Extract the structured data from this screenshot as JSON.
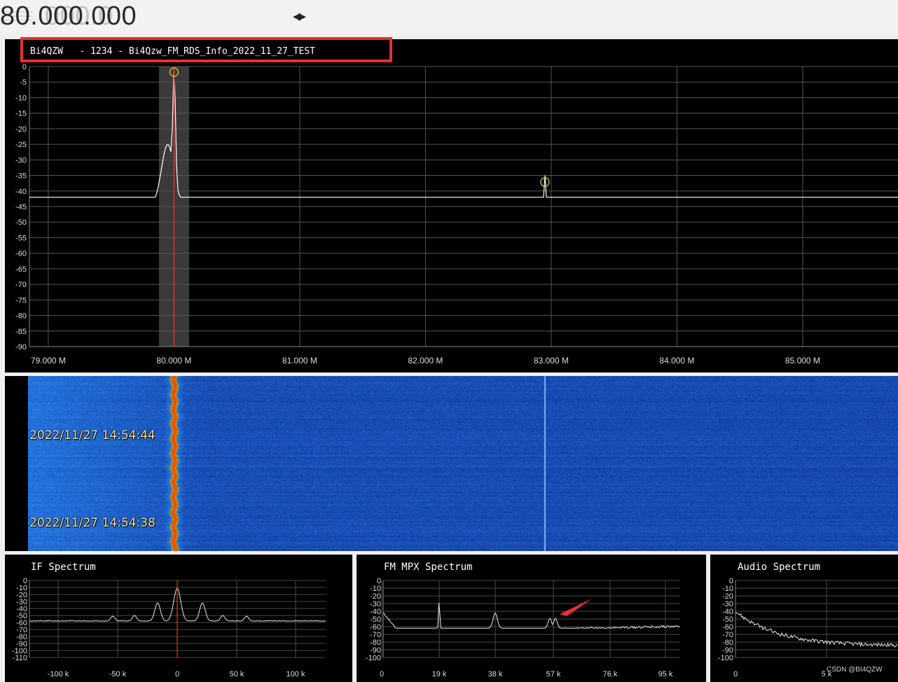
{
  "frequency": {
    "dim_digits": "000.0",
    "main_digits": "80.000.000",
    "arrows_glyph": "◂▸"
  },
  "main_spectrum": {
    "station_label": "Bi4QZW   - 1234 - Bi4Qzw_FM_RDS_Info_2022_11_27_TEST",
    "y_ticks": [
      "0",
      "-5",
      "-10",
      "-15",
      "-20",
      "-25",
      "-30",
      "-35",
      "-40",
      "-45",
      "-50",
      "-55",
      "-60",
      "-65",
      "-70",
      "-75",
      "-80",
      "-85",
      "-90"
    ],
    "x_ticks": [
      "79.000 M",
      "80.000 M",
      "81.000 M",
      "82.000 M",
      "83.000 M",
      "84.000 M",
      "85.000 M"
    ],
    "tuned_frequency": "80.000 M",
    "peak_markers": [
      "80.000 M",
      "82.950 M"
    ]
  },
  "waterfall": {
    "timestamps": [
      "2022/11/27 14:54:44",
      "2022/11/27 14:54:38"
    ]
  },
  "if_spectrum": {
    "title": "IF Spectrum",
    "y_ticks": [
      "0",
      "-10",
      "-20",
      "-30",
      "-40",
      "-50",
      "-60",
      "-70",
      "-80",
      "-90",
      "-100",
      "-110"
    ],
    "x_ticks": [
      "-100 k",
      "-50 k",
      "0",
      "50 k",
      "100 k"
    ]
  },
  "fm_mpx_spectrum": {
    "title": "FM MPX Spectrum",
    "y_ticks": [
      "0",
      "-10",
      "-20",
      "-30",
      "-40",
      "-50",
      "-60",
      "-70",
      "-80",
      "-90",
      "-100"
    ],
    "x_ticks": [
      "0",
      "19 k",
      "38 k",
      "57 k",
      "76 k",
      "95 k"
    ]
  },
  "audio_spectrum": {
    "title": "Audio Spectrum",
    "y_ticks": [
      "0",
      "-10",
      "-20",
      "-30",
      "-40",
      "-50",
      "-60",
      "-70",
      "-80",
      "-90",
      "-100"
    ],
    "x_ticks": [
      "0",
      "5 k"
    ]
  },
  "watermark": "CSDN @BI4QZW",
  "colors": {
    "accent_red": "#e53036",
    "marker_yellow": "#e8e020",
    "waterfall_base": "#0a1f9c",
    "panel_bg": "#000000"
  }
}
